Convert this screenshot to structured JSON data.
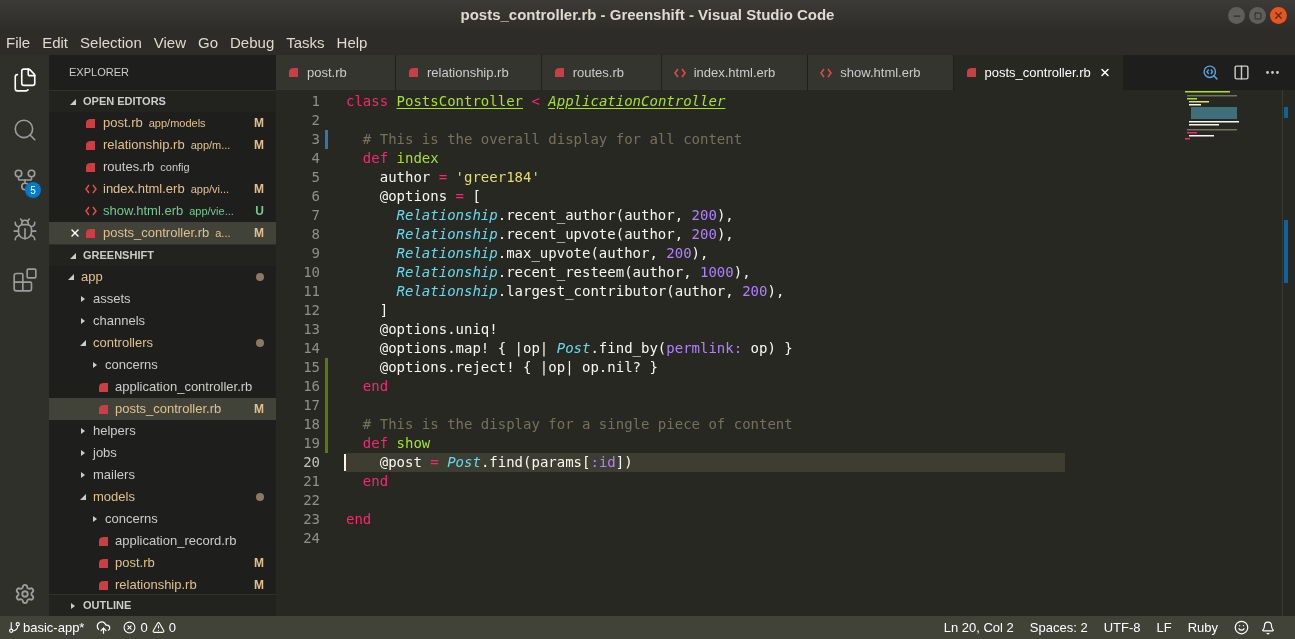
{
  "window": {
    "title": "posts_controller.rb - Greenshift - Visual Studio Code"
  },
  "menu": [
    "File",
    "Edit",
    "Selection",
    "View",
    "Go",
    "Debug",
    "Tasks",
    "Help"
  ],
  "activity_bar": [
    {
      "kind": "files",
      "selected": true
    },
    {
      "kind": "search",
      "selected": false
    },
    {
      "kind": "git",
      "selected": false,
      "badge": "5"
    },
    {
      "kind": "debug",
      "selected": false
    },
    {
      "kind": "extensions",
      "selected": false
    }
  ],
  "sidebar": {
    "title": "EXPLORER",
    "open_editors": {
      "title": "OPEN EDITORS",
      "expanded": true,
      "items": [
        {
          "name": "post.rb",
          "path": "app/models",
          "status": "M",
          "color": "#e2c08d",
          "kind": "ruby",
          "selected": false
        },
        {
          "name": "relationship.rb",
          "path": "app/m...",
          "status": "M",
          "color": "#e2c08d",
          "kind": "ruby",
          "selected": false
        },
        {
          "name": "routes.rb",
          "path": "config",
          "kind": "ruby",
          "color": "#cccccc",
          "selected": false
        },
        {
          "name": "index.html.erb",
          "path": "app/vi...",
          "status": "M",
          "color": "#e2c08d",
          "kind": "html",
          "selected": false
        },
        {
          "name": "show.html.erb",
          "path": "app/vie...",
          "status": "U",
          "color": "#73c991",
          "kind": "html",
          "selected": false
        },
        {
          "name": "posts_controller.rb",
          "path": "a...",
          "status": "M",
          "color": "#e2c08d",
          "kind": "ruby",
          "selected": true
        }
      ]
    },
    "folder": {
      "title": "GREENSHIFT",
      "expanded": true,
      "tree": [
        {
          "name": "app",
          "folder": true,
          "expanded": true,
          "dot": true,
          "children": [
            {
              "name": "assets",
              "folder": true,
              "expanded": false
            },
            {
              "name": "channels",
              "folder": true,
              "expanded": false
            },
            {
              "name": "controllers",
              "folder": true,
              "expanded": true,
              "dot": true,
              "children": [
                {
                  "name": "concerns",
                  "folder": true,
                  "expanded": false
                },
                {
                  "name": "application_controller.rb",
                  "selected": false
                },
                {
                  "name": "posts_controller.rb",
                  "status": "M",
                  "selected": true
                }
              ]
            },
            {
              "name": "helpers",
              "folder": true,
              "expanded": false
            },
            {
              "name": "jobs",
              "folder": true,
              "expanded": false
            },
            {
              "name": "mailers",
              "folder": true,
              "expanded": false
            },
            {
              "name": "models",
              "folder": true,
              "expanded": true,
              "dot": true,
              "children": [
                {
                  "name": "concerns",
                  "folder": true,
                  "expanded": false
                },
                {
                  "name": "application_record.rb",
                  "selected": false
                },
                {
                  "name": "post.rb",
                  "status": "M",
                  "selected": false
                },
                {
                  "name": "relationship.rb",
                  "status": "M",
                  "selected": false
                }
              ]
            }
          ]
        }
      ]
    },
    "outline": {
      "title": "OUTLINE",
      "expanded": false
    }
  },
  "tabs": [
    {
      "label": "post.rb",
      "kind": "ruby",
      "selected": false
    },
    {
      "label": "relationship.rb",
      "kind": "ruby",
      "selected": false
    },
    {
      "label": "routes.rb",
      "kind": "ruby",
      "selected": false
    },
    {
      "label": "index.html.erb",
      "kind": "html",
      "selected": false
    },
    {
      "label": "show.html.erb",
      "kind": "html",
      "selected": false
    },
    {
      "label": "posts_controller.rb",
      "kind": "ruby",
      "selected": true
    }
  ],
  "code": [
    {
      "n": "1",
      "modified": false,
      "added": false,
      "current": false,
      "tokens": [
        {
          "t": "class ",
          "kind": "kw"
        },
        {
          "t": "PostsController",
          "kind": "cls"
        },
        {
          "t": " < ",
          "kind": "kw"
        },
        {
          "t": "ApplicationController",
          "kind": "inh"
        }
      ]
    },
    {
      "n": "2",
      "modified": false,
      "added": false,
      "current": false
    },
    {
      "n": "3",
      "modified": true,
      "added": false,
      "current": false,
      "tokens": [
        {
          "t": "  # This is the overall display for all content",
          "kind": "cm"
        }
      ]
    },
    {
      "n": "4",
      "modified": false,
      "added": false,
      "current": false,
      "tokens": [
        {
          "t": "  def ",
          "kind": "kw"
        },
        {
          "t": "index",
          "kind": "fn"
        }
      ]
    },
    {
      "n": "5",
      "modified": false,
      "added": false,
      "current": false,
      "tokens": [
        {
          "t": "    author ",
          "kind": "p"
        },
        {
          "t": "=",
          "kind": "kw"
        },
        {
          "t": " 'greer184'",
          "kind": "str"
        }
      ]
    },
    {
      "n": "6",
      "modified": false,
      "added": false,
      "current": false,
      "tokens": [
        {
          "t": "    @options ",
          "kind": "p"
        },
        {
          "t": "=",
          "kind": "kw"
        },
        {
          "t": " [",
          "kind": "p"
        }
      ]
    },
    {
      "n": "7",
      "modified": false,
      "added": false,
      "current": false,
      "tokens": [
        {
          "t": "      Relationship",
          "kind": "cst"
        },
        {
          "t": ".recent_author(author, ",
          "kind": "p"
        },
        {
          "t": "200",
          "kind": "num"
        },
        {
          "t": "),",
          "kind": "p"
        }
      ]
    },
    {
      "n": "8",
      "modified": false,
      "added": false,
      "current": false,
      "tokens": [
        {
          "t": "      Relationship",
          "kind": "cst"
        },
        {
          "t": ".recent_upvote(author, ",
          "kind": "p"
        },
        {
          "t": "200",
          "kind": "num"
        },
        {
          "t": "),",
          "kind": "p"
        }
      ]
    },
    {
      "n": "9",
      "modified": false,
      "added": false,
      "current": false,
      "tokens": [
        {
          "t": "      Relationship",
          "kind": "cst"
        },
        {
          "t": ".max_upvote(author, ",
          "kind": "p"
        },
        {
          "t": "200",
          "kind": "num"
        },
        {
          "t": "),",
          "kind": "p"
        }
      ]
    },
    {
      "n": "10",
      "modified": false,
      "added": false,
      "current": false,
      "tokens": [
        {
          "t": "      Relationship",
          "kind": "cst"
        },
        {
          "t": ".recent_resteem(author, ",
          "kind": "p"
        },
        {
          "t": "1000",
          "kind": "num"
        },
        {
          "t": "),",
          "kind": "p"
        }
      ]
    },
    {
      "n": "11",
      "modified": false,
      "added": false,
      "current": false,
      "tokens": [
        {
          "t": "      Relationship",
          "kind": "cst"
        },
        {
          "t": ".largest_contributor(author, ",
          "kind": "p"
        },
        {
          "t": "200",
          "kind": "num"
        },
        {
          "t": "),",
          "kind": "p"
        }
      ]
    },
    {
      "n": "12",
      "modified": false,
      "added": false,
      "current": false,
      "tokens": [
        {
          "t": "    ]",
          "kind": "p"
        }
      ]
    },
    {
      "n": "13",
      "modified": false,
      "added": false,
      "current": false,
      "tokens": [
        {
          "t": "    @options.uniq!",
          "kind": "p"
        }
      ]
    },
    {
      "n": "14",
      "modified": false,
      "added": false,
      "current": false,
      "tokens": [
        {
          "t": "    @options.map! { |op| ",
          "kind": "p"
        },
        {
          "t": "Post",
          "kind": "cst"
        },
        {
          "t": ".find_by(",
          "kind": "p"
        },
        {
          "t": "permlink:",
          "kind": "num"
        },
        {
          "t": " op) }",
          "kind": "p"
        }
      ]
    },
    {
      "n": "15",
      "modified": false,
      "added": true,
      "current": false,
      "tokens": [
        {
          "t": "    @options.reject! { |op| op.nil? }",
          "kind": "p"
        }
      ]
    },
    {
      "n": "16",
      "modified": false,
      "added": true,
      "current": false,
      "tokens": [
        {
          "t": "  end",
          "kind": "kw"
        }
      ]
    },
    {
      "n": "17",
      "modified": false,
      "added": true,
      "current": false
    },
    {
      "n": "18",
      "modified": false,
      "added": true,
      "current": false,
      "tokens": [
        {
          "t": "  # This is the display for a single piece of content",
          "kind": "cm"
        }
      ]
    },
    {
      "n": "19",
      "modified": false,
      "added": true,
      "current": false,
      "tokens": [
        {
          "t": "  def ",
          "kind": "kw"
        },
        {
          "t": "show",
          "kind": "fn"
        }
      ]
    },
    {
      "n": "20",
      "modified": false,
      "added": false,
      "current": true,
      "tokens": [
        {
          "t": "    @post ",
          "kind": "p"
        },
        {
          "t": "=",
          "kind": "kw"
        },
        {
          "t": " Post",
          "kind": "cst"
        },
        {
          "t": ".find(params[",
          "kind": "p"
        },
        {
          "t": ":id",
          "kind": "num"
        },
        {
          "t": "])",
          "kind": "p"
        }
      ]
    },
    {
      "n": "21",
      "modified": false,
      "added": false,
      "current": false,
      "tokens": [
        {
          "t": "  end",
          "kind": "kw"
        }
      ]
    },
    {
      "n": "22",
      "modified": false,
      "added": false,
      "current": false
    },
    {
      "n": "23",
      "modified": false,
      "added": false,
      "current": false,
      "tokens": [
        {
          "t": "end",
          "kind": "kw"
        }
      ]
    },
    {
      "n": "24",
      "modified": false,
      "added": false,
      "current": false
    }
  ],
  "status_bar": {
    "branch": "basic-app*",
    "errors": "0",
    "warnings": "0",
    "position": "Ln 20, Col 2",
    "indent": "Spaces: 2",
    "encoding": "UTF-8",
    "eol": "LF",
    "language": "Ruby"
  }
}
